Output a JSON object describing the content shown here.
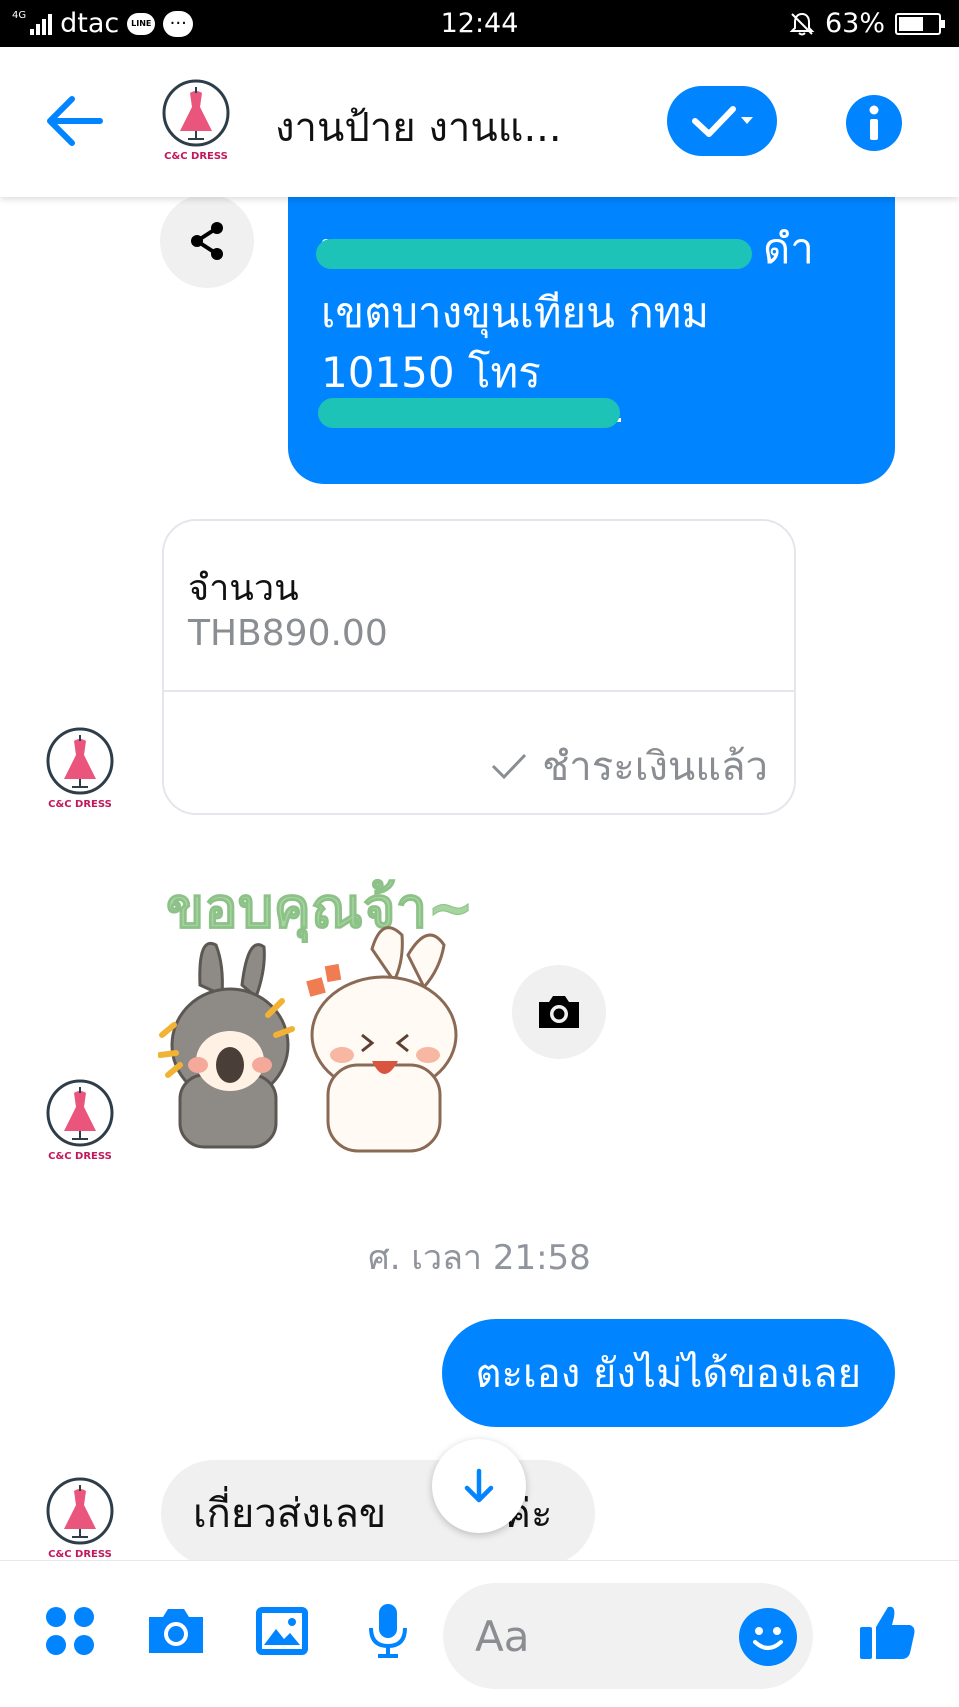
{
  "status_bar": {
    "network": "4G",
    "carrier": "dtac",
    "app_badge": "LINE",
    "time": "12:44",
    "battery": "63%",
    "battery_level": 0.63
  },
  "header": {
    "title": "งานป้าย งานแ...",
    "avatar_text": "C&C DRESS"
  },
  "address_bubble": {
    "lines": [
      "พร",
      "เขตบางขุนเทียน กทม",
      "10150 โทร"
    ],
    "line1_tail": "ดำ"
  },
  "payment": {
    "label": "จำนวน",
    "amount": "THB890.00",
    "status": "ชำระเงินแล้ว"
  },
  "sticker": {
    "text": "ขอบคุณจ้า~"
  },
  "timestamp": "ศ. เวลา 21:58",
  "outgoing_message": "ตะเอง ยังไม่ได้ของเลย",
  "incoming_message": "เกี่ยวส่งเลข",
  "incoming_message_tail": "ค่ะ",
  "composer": {
    "placeholder": "Aa"
  },
  "colors": {
    "accent": "#0084ff",
    "bubble_in": "#f1f0f0",
    "scribble": "#1cc3b6"
  }
}
